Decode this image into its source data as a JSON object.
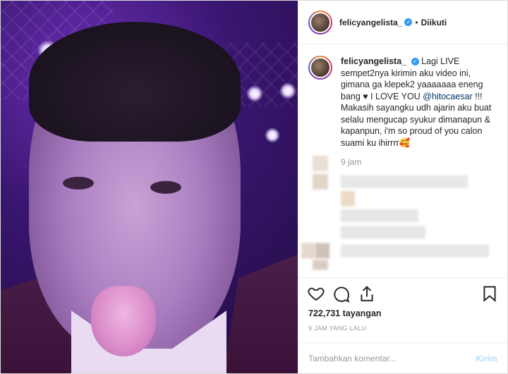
{
  "header": {
    "username": "felicyangelista_",
    "separator": "•",
    "follow_status": "Diikuti"
  },
  "caption": {
    "username": "felicyangelista_",
    "text_before_mention": "Lagi LIVE sempet2nya kirimin aku video ini, gimana ga klepek2 yaaaaaaa eneng bang ♥ I LOVE YOU",
    "mention": "@hitocaesar",
    "text_after_mention": "!!! Makasih sayangku udh ajarin aku buat selalu mengucap syukur dimanapun & kapanpun, i'm so proud of you calon suami ku ihirrrr🥰",
    "time": "9 jam"
  },
  "stats": {
    "views": "722,731 tayangan",
    "posted_ago": "9 JAM YANG LALU"
  },
  "comment_box": {
    "placeholder": "Tambahkan komentar...",
    "post_label": "Kirim"
  },
  "icons": {
    "like": "heart-icon",
    "comment": "comment-icon",
    "share": "share-icon",
    "save": "bookmark-icon",
    "verified": "verified-badge-icon"
  },
  "colors": {
    "verified": "#3897f0",
    "mention": "#003569",
    "post_button_disabled": "#b2dffc"
  }
}
